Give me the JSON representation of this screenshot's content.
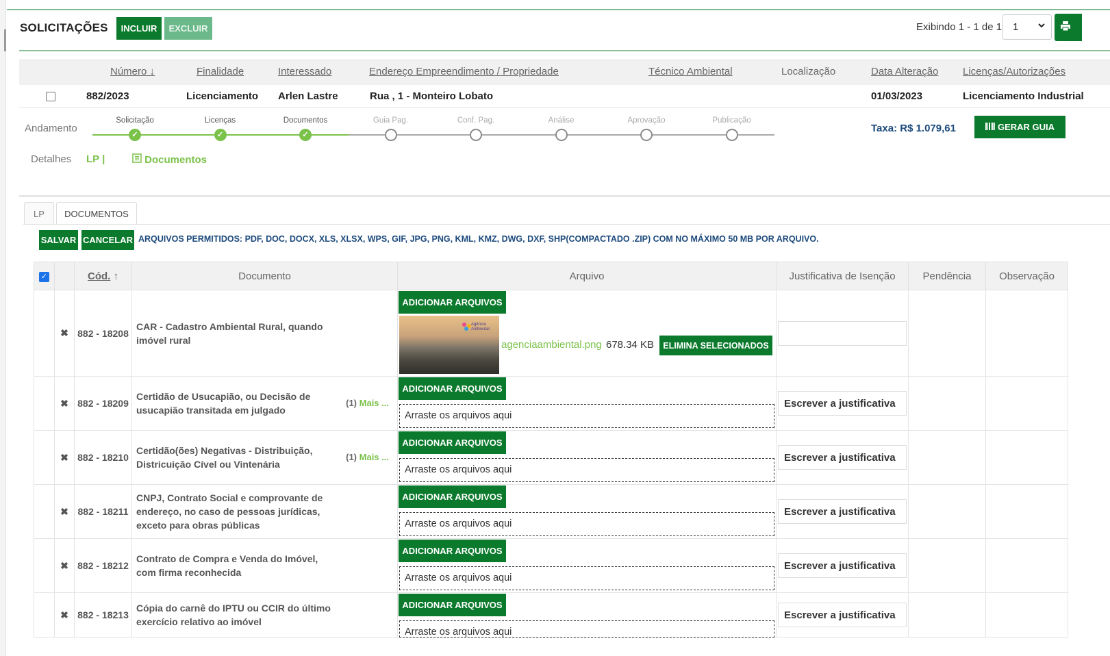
{
  "header": {
    "title": "SOLICITAÇÕES",
    "incluir_label": "INCLUIR",
    "excluir_label": "EXCLUIR",
    "paging_text": "Exibindo 1 - 1 de 1",
    "page_value": "1"
  },
  "grid": {
    "columns": [
      "Número",
      "Finalidade",
      "Interessado",
      "Endereço Empreendimento / Propriedade",
      "Técnico Ambiental",
      "Localização",
      "Data Alteração",
      "Licenças/Autorizações"
    ],
    "sort_arrow": "↓",
    "row": {
      "numero": "882/2023",
      "finalidade": "Licenciamento",
      "interessado": "Arlen Lastre",
      "endereco": "Rua , 1 - Monteiro Lobato",
      "tecnico": "",
      "localizacao": "",
      "data": "01/03/2023",
      "licencas": "Licenciamento Industrial"
    }
  },
  "progress": {
    "label": "Andamento",
    "steps": [
      {
        "label": "Solicitação",
        "done": true
      },
      {
        "label": "Licenças",
        "done": true
      },
      {
        "label": "Documentos",
        "done": true
      },
      {
        "label": "Guia Pag.",
        "done": false
      },
      {
        "label": "Conf. Pag.",
        "done": false
      },
      {
        "label": "Análise",
        "done": false
      },
      {
        "label": "Aprovação",
        "done": false
      },
      {
        "label": "Publicação",
        "done": false
      }
    ],
    "taxa": "Taxa: R$ 1.079,61",
    "gerar_guia_label": "GERAR GUIA"
  },
  "details": {
    "label": "Detalhes",
    "lp_link": "LP |",
    "docs_link": "Documentos"
  },
  "tabs": [
    "LP",
    "DOCUMENTOS"
  ],
  "docs_toolbar": {
    "salvar_label": "SALVAR",
    "cancelar_label": "CANCELAR",
    "allowed_text": "ARQUIVOS PERMITIDOS: PDF, DOC, DOCX, XLS, XLSX, WPS, GIF, JPG, PNG, KML, KMZ, DWG, DXF, SHP(COMPACTADO .ZIP) COM NO MÁXIMO 50 MB POR ARQUIVO."
  },
  "docs_table": {
    "headers": {
      "cod": "Cód.",
      "cod_arrow": "↑",
      "documento": "Documento",
      "arquivo": "Arquivo",
      "justificativa": "Justificativa de Isenção",
      "pendencia": "Pendência",
      "observacao": "Observação"
    },
    "add_label": "ADICIONAR ARQUIVOS",
    "drop_text": "Arraste os arquivos aqui",
    "just_placeholder": "Escrever a justificativa",
    "rows": [
      {
        "cod": "882 - 18208",
        "documento": "CAR - Cadastro Ambiental Rural, quando imóvel rural",
        "mais": ""
      },
      {
        "cod": "882 - 18209",
        "documento": "Certidão de Usucapião, ou Decisão de usucapião transitada em julgado",
        "mais_count": "(1)",
        "mais": "Mais ..."
      },
      {
        "cod": "882 - 18210",
        "documento": "Certidão(ões) Negativas - Distribuição, Districuição Cível ou Vintenária",
        "mais_count": "(1)",
        "mais": "Mais ..."
      },
      {
        "cod": "882 - 18211",
        "documento": "CNPJ, Contrato Social e comprovante de endereço, no caso de pessoas jurídicas, exceto para obras públicas",
        "mais": ""
      },
      {
        "cod": "882 - 18212",
        "documento": "Contrato de Compra e Venda do Imóvel, com firma reconhecida",
        "mais": ""
      },
      {
        "cod": "882 - 18213",
        "documento": "Cópia do carnê do IPTU ou CCIR do último exercício relativo ao imóvel",
        "mais": ""
      }
    ],
    "file": {
      "name": "agenciaambiental.png",
      "size": "678.34 KB",
      "elimina_label": "ELIMINA SELECIONADOS",
      "logo_text": "Agência Ambiental"
    }
  },
  "colors": {
    "green": "#0b7a2c",
    "light_green": "#7bc24a",
    "blue_text": "#1d4a7c"
  }
}
